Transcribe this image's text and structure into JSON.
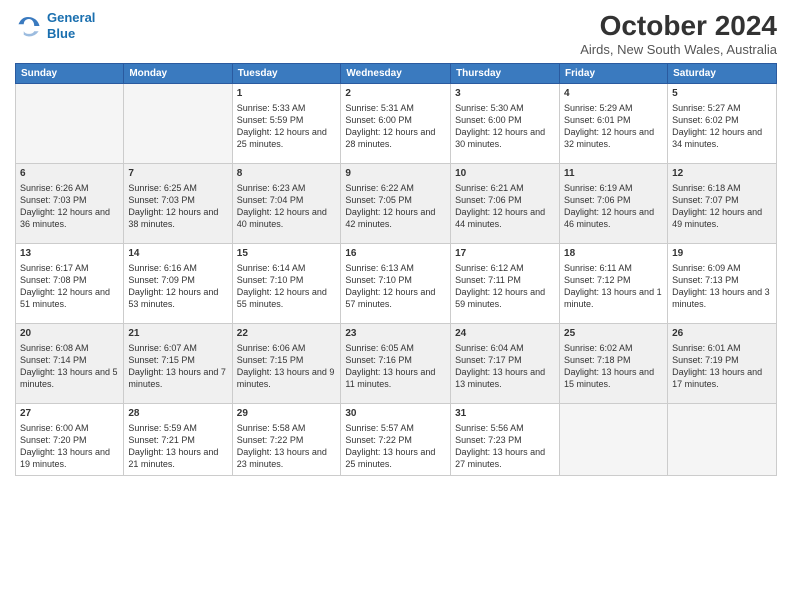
{
  "header": {
    "logo_line1": "General",
    "logo_line2": "Blue",
    "month": "October 2024",
    "location": "Airds, New South Wales, Australia"
  },
  "days_of_week": [
    "Sunday",
    "Monday",
    "Tuesday",
    "Wednesday",
    "Thursday",
    "Friday",
    "Saturday"
  ],
  "weeks": [
    {
      "days": [
        {
          "num": "",
          "empty": true
        },
        {
          "num": "",
          "empty": true
        },
        {
          "num": "1",
          "sunrise": "5:33 AM",
          "sunset": "5:59 PM",
          "daylight": "12 hours and 25 minutes."
        },
        {
          "num": "2",
          "sunrise": "5:31 AM",
          "sunset": "6:00 PM",
          "daylight": "12 hours and 28 minutes."
        },
        {
          "num": "3",
          "sunrise": "5:30 AM",
          "sunset": "6:00 PM",
          "daylight": "12 hours and 30 minutes."
        },
        {
          "num": "4",
          "sunrise": "5:29 AM",
          "sunset": "6:01 PM",
          "daylight": "12 hours and 32 minutes."
        },
        {
          "num": "5",
          "sunrise": "5:27 AM",
          "sunset": "6:02 PM",
          "daylight": "12 hours and 34 minutes."
        }
      ]
    },
    {
      "days": [
        {
          "num": "6",
          "sunrise": "6:26 AM",
          "sunset": "7:03 PM",
          "daylight": "12 hours and 36 minutes."
        },
        {
          "num": "7",
          "sunrise": "6:25 AM",
          "sunset": "7:03 PM",
          "daylight": "12 hours and 38 minutes."
        },
        {
          "num": "8",
          "sunrise": "6:23 AM",
          "sunset": "7:04 PM",
          "daylight": "12 hours and 40 minutes."
        },
        {
          "num": "9",
          "sunrise": "6:22 AM",
          "sunset": "7:05 PM",
          "daylight": "12 hours and 42 minutes."
        },
        {
          "num": "10",
          "sunrise": "6:21 AM",
          "sunset": "7:06 PM",
          "daylight": "12 hours and 44 minutes."
        },
        {
          "num": "11",
          "sunrise": "6:19 AM",
          "sunset": "7:06 PM",
          "daylight": "12 hours and 46 minutes."
        },
        {
          "num": "12",
          "sunrise": "6:18 AM",
          "sunset": "7:07 PM",
          "daylight": "12 hours and 49 minutes."
        }
      ]
    },
    {
      "days": [
        {
          "num": "13",
          "sunrise": "6:17 AM",
          "sunset": "7:08 PM",
          "daylight": "12 hours and 51 minutes."
        },
        {
          "num": "14",
          "sunrise": "6:16 AM",
          "sunset": "7:09 PM",
          "daylight": "12 hours and 53 minutes."
        },
        {
          "num": "15",
          "sunrise": "6:14 AM",
          "sunset": "7:10 PM",
          "daylight": "12 hours and 55 minutes."
        },
        {
          "num": "16",
          "sunrise": "6:13 AM",
          "sunset": "7:10 PM",
          "daylight": "12 hours and 57 minutes."
        },
        {
          "num": "17",
          "sunrise": "6:12 AM",
          "sunset": "7:11 PM",
          "daylight": "12 hours and 59 minutes."
        },
        {
          "num": "18",
          "sunrise": "6:11 AM",
          "sunset": "7:12 PM",
          "daylight": "13 hours and 1 minute."
        },
        {
          "num": "19",
          "sunrise": "6:09 AM",
          "sunset": "7:13 PM",
          "daylight": "13 hours and 3 minutes."
        }
      ]
    },
    {
      "days": [
        {
          "num": "20",
          "sunrise": "6:08 AM",
          "sunset": "7:14 PM",
          "daylight": "13 hours and 5 minutes."
        },
        {
          "num": "21",
          "sunrise": "6:07 AM",
          "sunset": "7:15 PM",
          "daylight": "13 hours and 7 minutes."
        },
        {
          "num": "22",
          "sunrise": "6:06 AM",
          "sunset": "7:15 PM",
          "daylight": "13 hours and 9 minutes."
        },
        {
          "num": "23",
          "sunrise": "6:05 AM",
          "sunset": "7:16 PM",
          "daylight": "13 hours and 11 minutes."
        },
        {
          "num": "24",
          "sunrise": "6:04 AM",
          "sunset": "7:17 PM",
          "daylight": "13 hours and 13 minutes."
        },
        {
          "num": "25",
          "sunrise": "6:02 AM",
          "sunset": "7:18 PM",
          "daylight": "13 hours and 15 minutes."
        },
        {
          "num": "26",
          "sunrise": "6:01 AM",
          "sunset": "7:19 PM",
          "daylight": "13 hours and 17 minutes."
        }
      ]
    },
    {
      "days": [
        {
          "num": "27",
          "sunrise": "6:00 AM",
          "sunset": "7:20 PM",
          "daylight": "13 hours and 19 minutes."
        },
        {
          "num": "28",
          "sunrise": "5:59 AM",
          "sunset": "7:21 PM",
          "daylight": "13 hours and 21 minutes."
        },
        {
          "num": "29",
          "sunrise": "5:58 AM",
          "sunset": "7:22 PM",
          "daylight": "13 hours and 23 minutes."
        },
        {
          "num": "30",
          "sunrise": "5:57 AM",
          "sunset": "7:22 PM",
          "daylight": "13 hours and 25 minutes."
        },
        {
          "num": "31",
          "sunrise": "5:56 AM",
          "sunset": "7:23 PM",
          "daylight": "13 hours and 27 minutes."
        },
        {
          "num": "",
          "empty": true
        },
        {
          "num": "",
          "empty": true
        }
      ]
    }
  ],
  "labels": {
    "sunrise": "Sunrise:",
    "sunset": "Sunset:",
    "daylight": "Daylight:"
  }
}
